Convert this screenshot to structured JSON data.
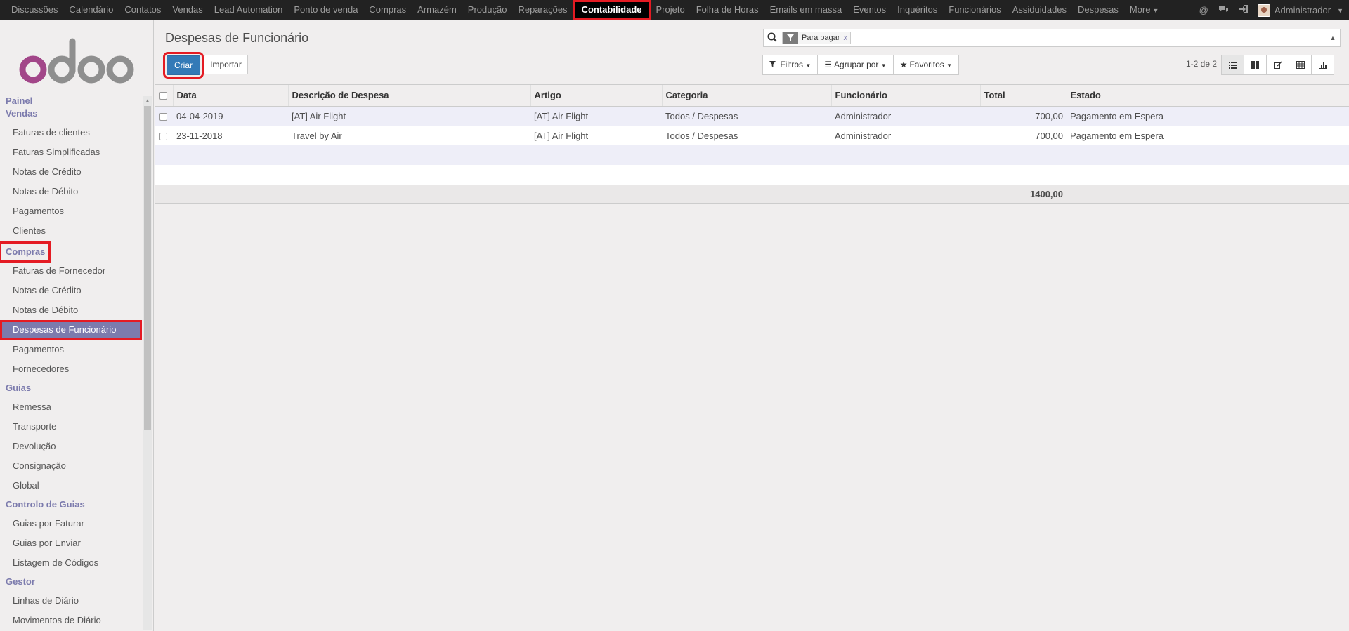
{
  "topnav": {
    "items": [
      "Discussões",
      "Calendário",
      "Contatos",
      "Vendas",
      "Lead Automation",
      "Ponto de venda",
      "Compras",
      "Armazém",
      "Produção",
      "Reparações",
      "Contabilidade",
      "Projeto",
      "Folha de Horas",
      "Emails em massa",
      "Eventos",
      "Inquéritos",
      "Funcionários",
      "Assiduidades",
      "Despesas",
      "More"
    ],
    "active": "Contabilidade",
    "user": "Administrador"
  },
  "sidebar": {
    "logo": "odoo",
    "panel": "Painel",
    "vendas": {
      "title": "Vendas",
      "items": [
        "Faturas de clientes",
        "Faturas Simplificadas",
        "Notas de Crédito",
        "Notas de Débito",
        "Pagamentos",
        "Clientes"
      ]
    },
    "compras": {
      "title": "Compras",
      "items": [
        "Faturas de Fornecedor",
        "Notas de Crédito",
        "Notas de Débito",
        "Despesas de Funcionário",
        "Pagamentos",
        "Fornecedores"
      ]
    },
    "guias": {
      "title": "Guias",
      "items": [
        "Remessa",
        "Transporte",
        "Devolução",
        "Consignação",
        "Global"
      ]
    },
    "controlo": {
      "title": "Controlo de Guias",
      "items": [
        "Guias por Faturar",
        "Guias por Enviar",
        "Listagem de Códigos"
      ]
    },
    "gestor": {
      "title": "Gestor",
      "items": [
        "Linhas de Diário",
        "Movimentos de Diário"
      ]
    }
  },
  "main": {
    "title": "Despesas de Funcionário",
    "create_label": "Criar",
    "import_label": "Importar",
    "search": {
      "facet": "Para pagar",
      "facet_close": "x",
      "value": ""
    },
    "filters_label": "Filtros",
    "groupby_label": "Agrupar por",
    "favorites_label": "Favoritos",
    "pager": "1-2 de 2"
  },
  "table": {
    "columns": [
      "Data",
      "Descrição de Despesa",
      "Artigo",
      "Categoria",
      "Funcionário",
      "Total",
      "Estado"
    ],
    "rows": [
      {
        "date": "04-04-2019",
        "desc": "[AT] Air Flight",
        "product": "[AT] Air Flight",
        "category": "Todos / Despesas",
        "employee": "Administrador",
        "total": "700,00",
        "state": "Pagamento em Espera"
      },
      {
        "date": "23-11-2018",
        "desc": "Travel by Air",
        "product": "[AT] Air Flight",
        "category": "Todos / Despesas",
        "employee": "Administrador",
        "total": "700,00",
        "state": "Pagamento em Espera"
      }
    ],
    "sum_total": "1400,00"
  }
}
